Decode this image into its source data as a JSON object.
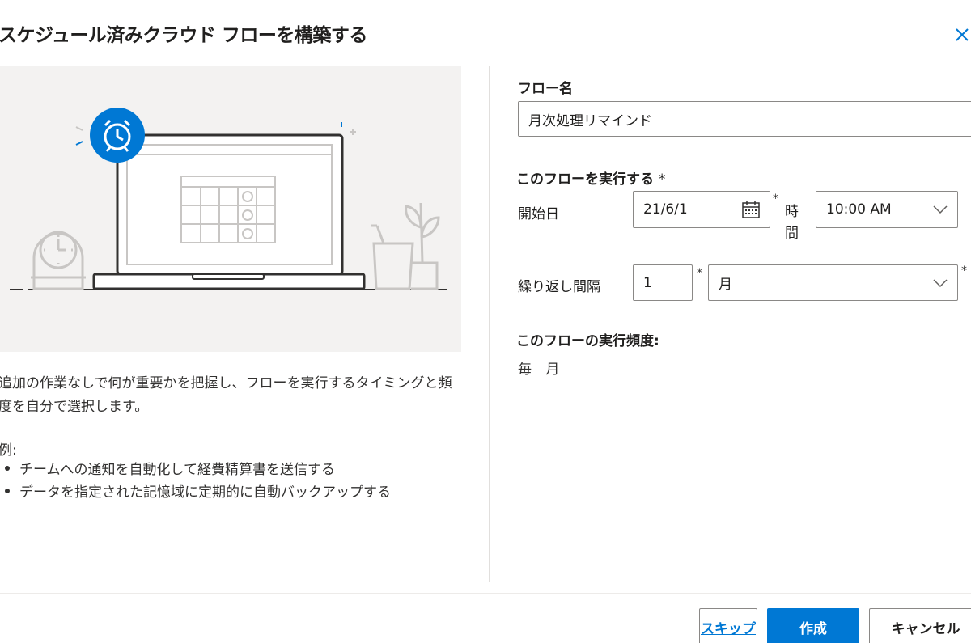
{
  "dialog": {
    "title": "スケジュール済みクラウド フローを構築する",
    "close_label": "×"
  },
  "left": {
    "description": "追加の作業なしで何が重要かを把握し、フローを実行するタイミングと頻度を自分で選択します。",
    "example_label": "例:",
    "examples": [
      "チームへの通知を自動化して経費精算書を送信する",
      "データを指定された記憶域に定期的に自動バックアップする"
    ]
  },
  "form": {
    "flow_name_label": "フロー名",
    "flow_name_value": "月次処理リマインド",
    "run_section_label": "このフローを実行する",
    "required_mark": "*",
    "start_date_label": "開始日",
    "start_date_value": "21/6/1",
    "time_label": "時間",
    "time_value": "10:00 AM",
    "interval_label": "繰り返し間隔",
    "interval_value": "1",
    "interval_unit": "月",
    "frequency_label": "このフローの実行頻度:",
    "frequency_value": "毎 月"
  },
  "buttons": {
    "skip": "スキップ",
    "create": "作成",
    "cancel": "キャンセル"
  },
  "colors": {
    "accent": "#0078d4",
    "illustration_bg": "#f3f2f1"
  }
}
